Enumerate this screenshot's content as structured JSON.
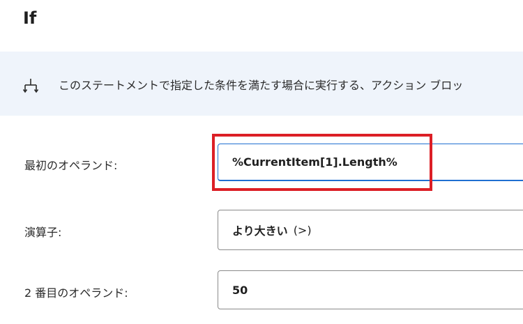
{
  "dialog": {
    "title": "If"
  },
  "info": {
    "icon": "split-branch-icon",
    "text": "このステートメントで指定した条件を満たす場合に実行する、アクション ブロッ"
  },
  "fields": {
    "first_operand": {
      "label": "最初のオペランド:",
      "value": "%CurrentItem[1].Length%"
    },
    "operator": {
      "label": "演算子:",
      "value_main": "より大きい",
      "value_symbol": "(>)"
    },
    "second_operand": {
      "label": "2 番目のオペランド:",
      "value": "50"
    }
  },
  "colors": {
    "highlight": "#dc1f26",
    "focus_border": "#1f6fd1",
    "banner_bg": "#eff4fb"
  }
}
